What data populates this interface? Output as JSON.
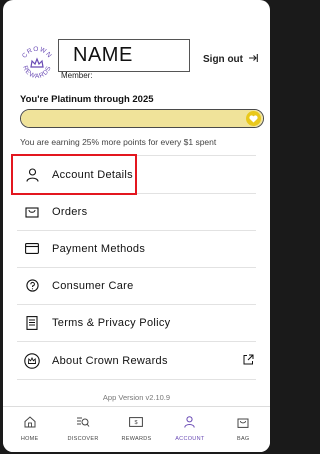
{
  "header": {
    "logo_text": "CROWN REWARDS",
    "name_placeholder": "NAME",
    "member_label": "Member:",
    "signout_label": "Sign out"
  },
  "tier": {
    "status_text": "You're Platinum through 2025",
    "progress_fraction": 1.0,
    "earn_text": "You are earning 25% more points for every $1 spent"
  },
  "menu": [
    {
      "label": "Account Details",
      "icon": "person-icon"
    },
    {
      "label": "Orders",
      "icon": "bag-icon"
    },
    {
      "label": "Payment Methods",
      "icon": "card-icon"
    },
    {
      "label": "Consumer Care",
      "icon": "help-icon"
    },
    {
      "label": "Terms & Privacy Policy",
      "icon": "document-icon"
    },
    {
      "label": "About Crown Rewards",
      "icon": "crown-icon"
    }
  ],
  "version": "App Version v2.10.9",
  "tabs": [
    {
      "label": "HOME",
      "icon": "home-icon"
    },
    {
      "label": "DISCOVER",
      "icon": "discover-icon"
    },
    {
      "label": "REWARDS",
      "icon": "rewards-icon"
    },
    {
      "label": "ACCOUNT",
      "icon": "account-icon"
    },
    {
      "label": "BAG",
      "icon": "bag-icon"
    }
  ],
  "colors": {
    "accent": "#6a4bb5",
    "progress_fill": "#f0e39a",
    "heart": "#e9c81b",
    "highlight": "#e3161f"
  }
}
